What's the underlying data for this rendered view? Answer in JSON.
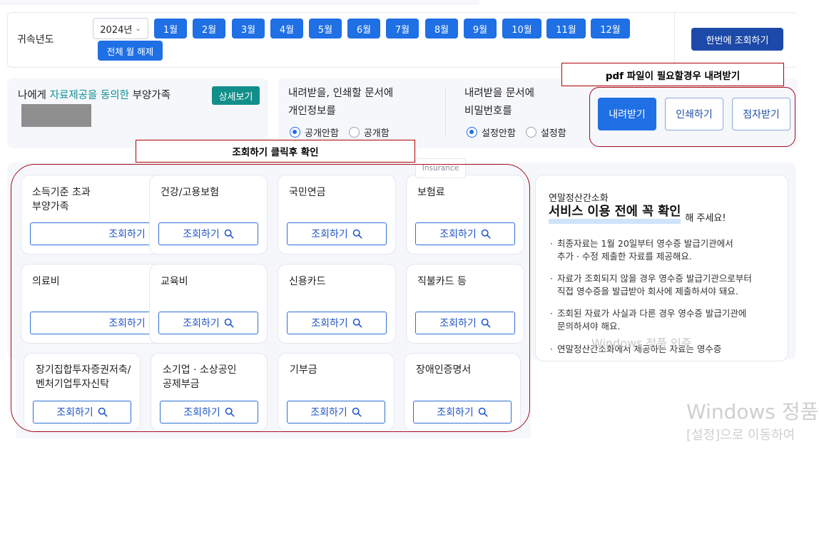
{
  "year_bar": {
    "label": "귀속년도",
    "year_value": "2024년",
    "months": [
      "1월",
      "2월",
      "3월",
      "4월",
      "5월",
      "6월",
      "7월",
      "8월",
      "9월",
      "10월",
      "11월",
      "12월"
    ],
    "clear_all": "전체 월 해제",
    "query_all": "한번에 조회하기"
  },
  "dependents": {
    "title_pre": "나에게 ",
    "title_highlight": "자료제공을 동의한",
    "title_post": " 부양가족",
    "detail_button": "상세보기"
  },
  "privacy": {
    "title_line1": "내려받을, 인쇄할 문서에",
    "title_line2": "개인정보를",
    "options": [
      "공개안함",
      "공개함"
    ],
    "selected": "공개안함"
  },
  "password": {
    "title_line1": "내려받을 문서에",
    "title_line2": "비밀번호를",
    "options": [
      "설정안함",
      "설정함"
    ],
    "selected": "설정안함"
  },
  "actions": {
    "download": "내려받기",
    "print": "인쇄하기",
    "braille": "점자받기"
  },
  "annotations": {
    "pdf_note": "pdf 파일이 필요할경우 내려받기",
    "query_note": "조회하기  클릭후 확인"
  },
  "cards": [
    {
      "title_line1": "소득기준 초과",
      "title_line2": "부양가족",
      "button": "조회하기"
    },
    {
      "title_line1": "건강/고용보험",
      "title_line2": "",
      "button": "조회하기"
    },
    {
      "title_line1": "국민연금",
      "title_line2": "",
      "button": "조회하기"
    },
    {
      "title_line1": "보험료",
      "title_line2": "",
      "button": "조회하기"
    },
    {
      "title_line1": "의료비",
      "title_line2": "",
      "button": "조회하기"
    },
    {
      "title_line1": "교육비",
      "title_line2": "",
      "button": "조회하기"
    },
    {
      "title_line1": "신용카드",
      "title_line2": "",
      "button": "조회하기"
    },
    {
      "title_line1": "직불카드 등",
      "title_line2": "",
      "button": "조회하기"
    },
    {
      "title_line1": "장기집합투자증권저축/",
      "title_line2": "벤처기업투자신탁",
      "button": "조회하기"
    },
    {
      "title_line1": "소기업 · 소상공인",
      "title_line2": "공제부금",
      "button": "조회하기"
    },
    {
      "title_line1": "기부금",
      "title_line2": "",
      "button": "조회하기"
    },
    {
      "title_line1": "장애인증명서",
      "title_line2": "",
      "button": "조회하기"
    }
  ],
  "insurance_tag": "Insurance",
  "notice": {
    "small_title": "연말정산간소화",
    "big_title": "서비스 이용 전에 꼭 확인",
    "tail": "해 주세요!",
    "bullets": [
      {
        "line1": "최종자료는 1월 20일부터 영수증 발급기관에서",
        "line2": "추가 · 수정 제출한 자료를 제공해요."
      },
      {
        "line1": "자료가 조회되지 않을 경우 영수증 발급기관으로부터",
        "line2": "직접 영수증을 발급받아 회사에 제출하셔야 돼요."
      },
      {
        "line1": "조회된 자료가 사실과 다른 경우 영수증 발급기관에",
        "line2": "문의하셔야 해요."
      },
      {
        "line1": "연말정산간소화에서 제공하는 자료는 영수증",
        "line2": ""
      }
    ]
  },
  "watermark": {
    "inner": "Windows 정품 인증",
    "title": "Windows 정품",
    "subtitle": "[설정]으로 이동하여"
  },
  "colors": {
    "primary_blue": "#1f6fe5",
    "dark_blue": "#1d4aa8",
    "teal": "#128f8a",
    "annotation_red": "#a80d1c"
  }
}
